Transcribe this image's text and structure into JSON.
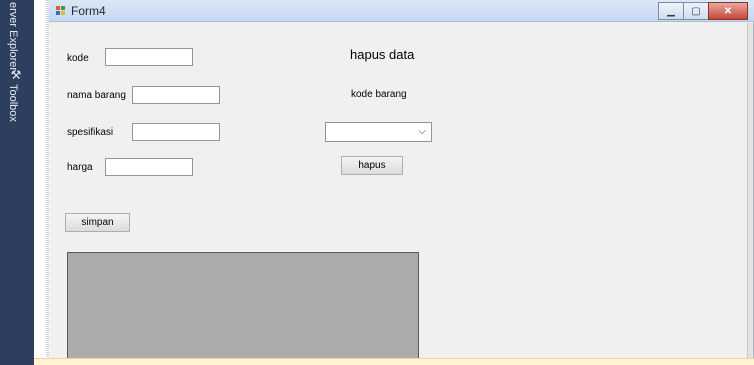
{
  "ide": {
    "side_tabs": [
      "erver Explorer",
      "Toolbox"
    ]
  },
  "window": {
    "title": "Form4"
  },
  "form": {
    "labels": {
      "kode": "kode",
      "nama_barang": "nama barang",
      "spesifikasi": "spesifikasi",
      "harga": "harga",
      "hapus_data": "hapus data",
      "kode_barang": "kode barang"
    },
    "inputs": {
      "kode": "",
      "nama_barang": "",
      "spesifikasi": "",
      "harga": ""
    },
    "combo_selected": "",
    "buttons": {
      "hapus": "hapus",
      "simpan": "simpan"
    }
  },
  "icons": {
    "title_icon": "form-icon",
    "toolbox_icon": "toolbox-icon",
    "minimize": "minimize-icon",
    "maximize": "maximize-icon",
    "close": "close-icon",
    "combo_arrow": "chevron-down-icon"
  },
  "colors": {
    "ide_sidebar": "#2d3e5f",
    "window_bg": "#f0f0f0",
    "close_button": "#c4473a",
    "grid_bg": "#ababab"
  }
}
